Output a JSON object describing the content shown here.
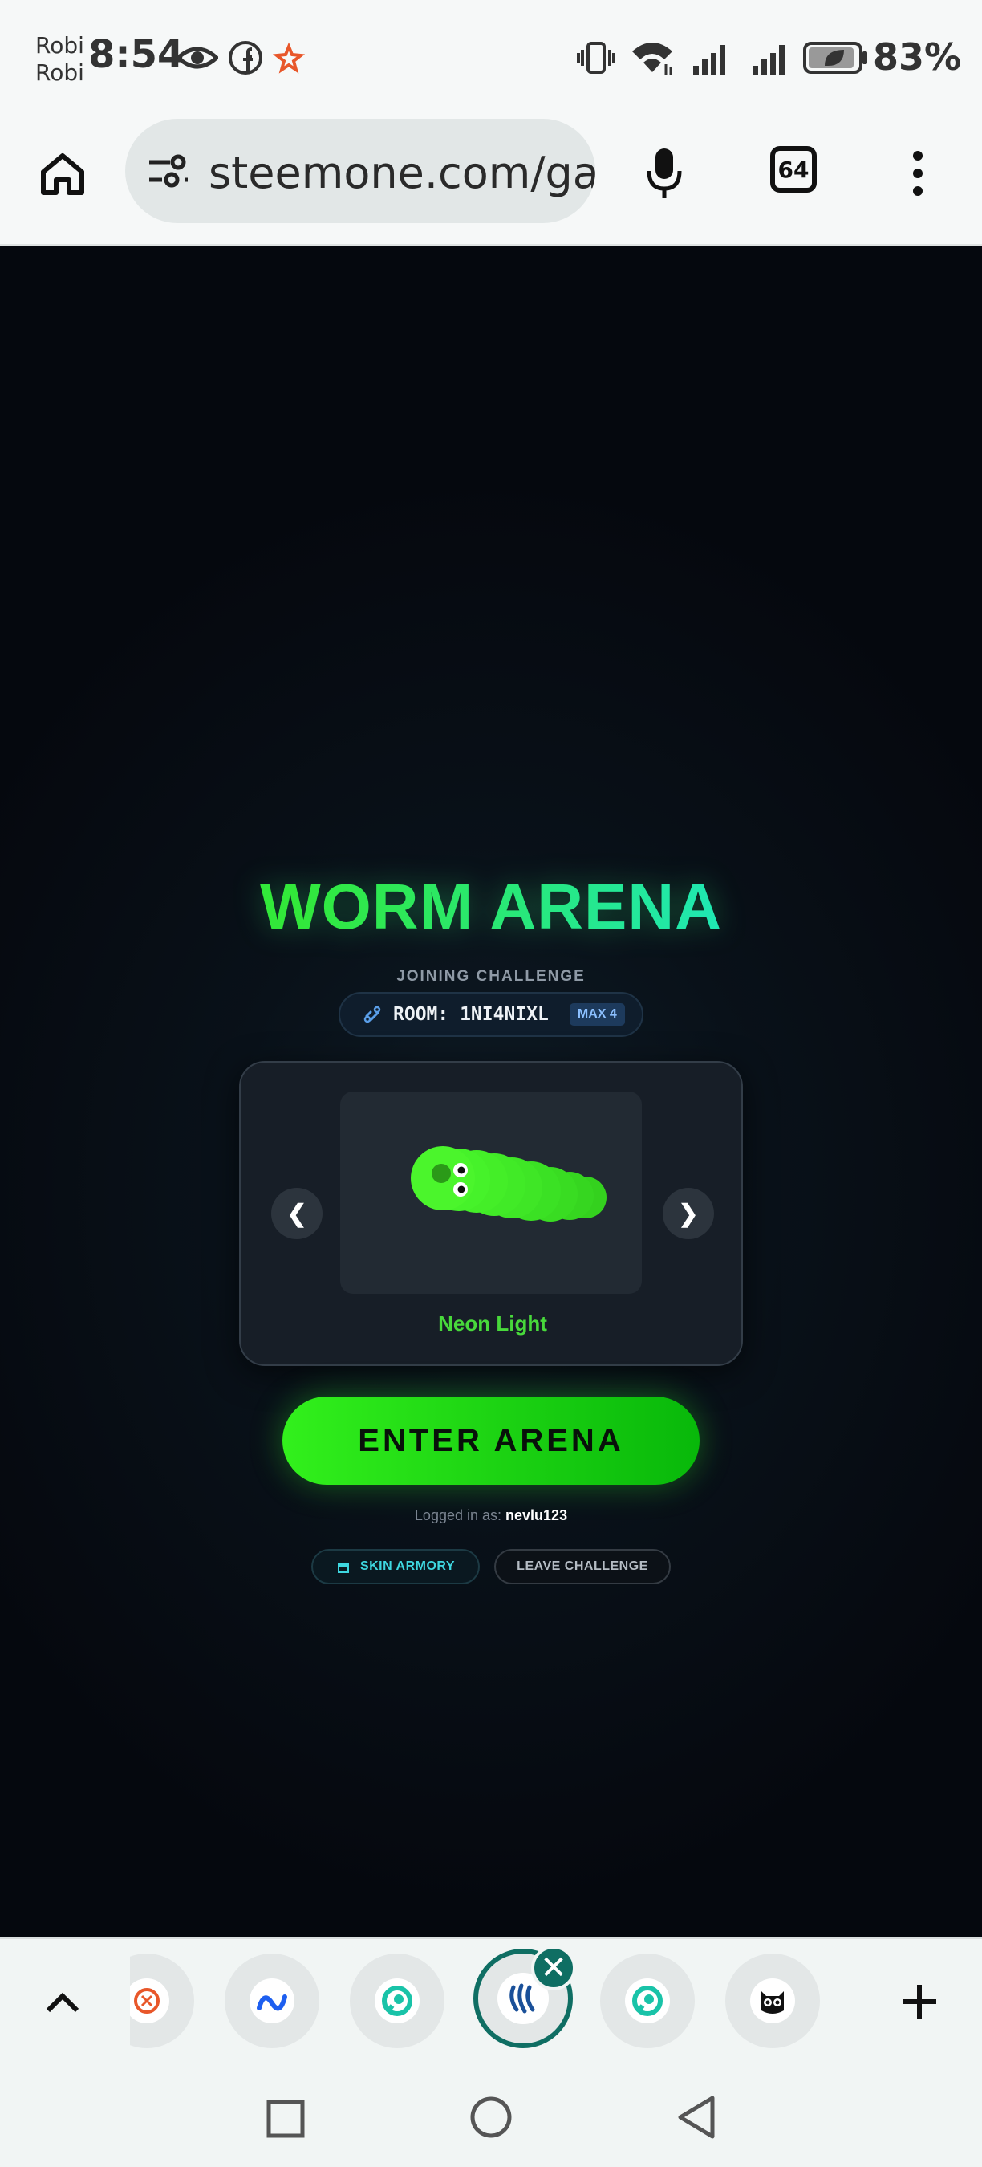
{
  "status_bar": {
    "carrier_line1": "Robi",
    "carrier_line2": "Robi",
    "time": "8:54",
    "battery_percent": "83%",
    "icons": [
      "eye-icon",
      "facebook-icon",
      "star-icon",
      "vibrate-icon",
      "wifi-icon",
      "signal-icon",
      "signal-icon",
      "battery-saver-icon"
    ]
  },
  "browser": {
    "url": "steemone.com/game",
    "tab_count": "64",
    "icons": [
      "home-icon",
      "site-settings-icon",
      "microphone-icon",
      "tabs-icon",
      "menu-icon"
    ]
  },
  "game": {
    "title": "WORM ARENA",
    "joining_label": "JOINING CHALLENGE",
    "room_label": "ROOM: 1NI4NIXL",
    "max_badge": "MAX 4",
    "prev_arrow": "❮",
    "next_arrow": "❯",
    "skin_name": "Neon Light",
    "enter_button": "ENTER ARENA",
    "logged_in_prefix": "Logged in as:",
    "username": "nevlu123",
    "skin_armory_button": "SKIN ARMORY",
    "leave_button": "LEAVE CHALLENGE",
    "colors": {
      "accent_green": "#32e83a",
      "accent_cyan": "#1fe8b8",
      "button_green": "#08b80a"
    }
  },
  "tab_strip": {
    "close_glyph": "✕",
    "tabs": [
      "firefox-dev-icon",
      "meta-icon",
      "steem-chat-icon",
      "steemit-icon",
      "steem-chat-icon",
      "owl-icon"
    ]
  }
}
